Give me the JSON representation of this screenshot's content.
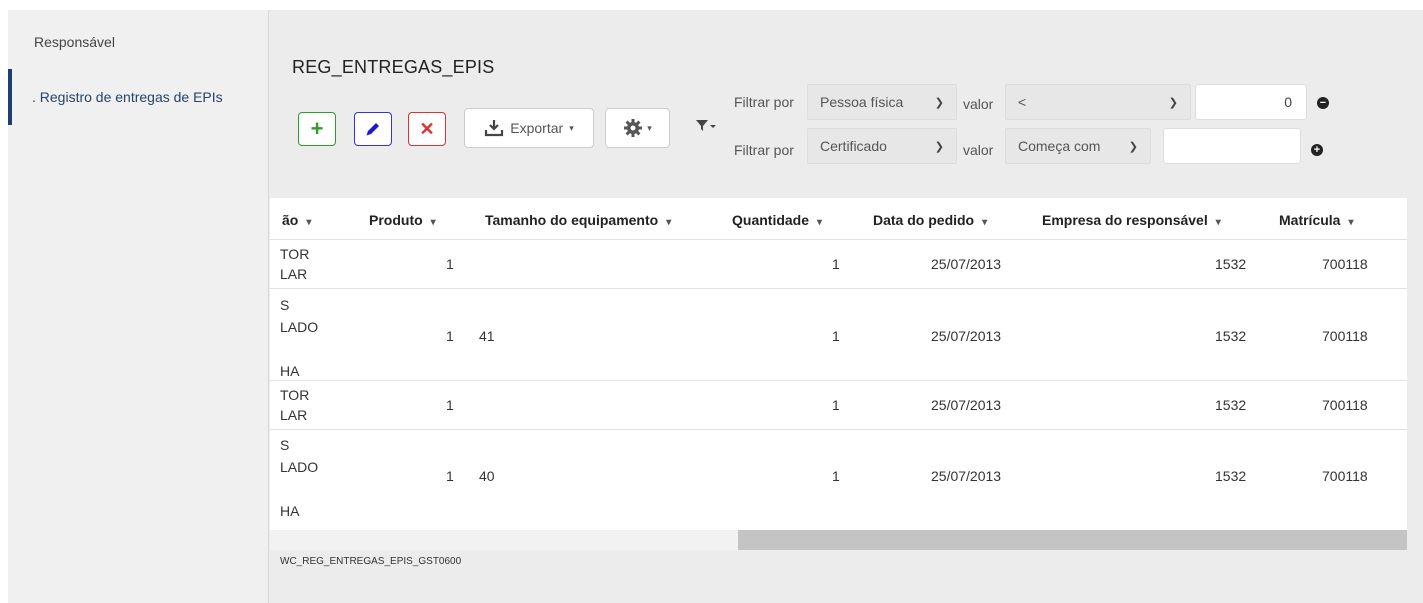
{
  "sidebar": {
    "header": "Responsável",
    "items": [
      {
        "label": ". Registro de entregas de EPIs"
      }
    ]
  },
  "page": {
    "title": "REG_ENTREGAS_EPIS",
    "footer_code": "WC_REG_ENTREGAS_EPIS_GST0600"
  },
  "toolbar": {
    "add_symbol": "+",
    "delete_symbol": "✕",
    "export_label": "Exportar",
    "caret": "▾"
  },
  "filters": [
    {
      "label": "Filtrar por",
      "field": "Pessoa física",
      "value_label": "valor",
      "operator": "<",
      "value": "0",
      "action": "−"
    },
    {
      "label": "Filtrar por",
      "field": "Certificado",
      "value_label": "valor",
      "operator": "Começa com",
      "value": "",
      "action": "+"
    }
  ],
  "table": {
    "columns": [
      "ão",
      "Produto",
      "Tamanho do equipamento",
      "Quantidade",
      "Data do pedido",
      "Empresa do responsável",
      "Matrícula"
    ],
    "sort_arrow": "▾",
    "rows": [
      {
        "cut_lines": [
          "TOR",
          "LAR"
        ],
        "produto": "1",
        "tamanho": "",
        "quantidade": "1",
        "data": "25/07/2013",
        "empresa": "1532",
        "matricula": "700118"
      },
      {
        "cut_lines": [
          "S",
          "LADO",
          "",
          "HA"
        ],
        "produto": "1",
        "tamanho": "41",
        "quantidade": "1",
        "data": "25/07/2013",
        "empresa": "1532",
        "matricula": "700118"
      },
      {
        "cut_lines": [
          "TOR",
          "LAR"
        ],
        "produto": "1",
        "tamanho": "",
        "quantidade": "1",
        "data": "25/07/2013",
        "empresa": "1532",
        "matricula": "700118"
      },
      {
        "cut_lines": [
          "S",
          "LADO",
          "",
          "HA"
        ],
        "produto": "1",
        "tamanho": "40",
        "quantidade": "1",
        "data": "25/07/2013",
        "empresa": "1532",
        "matricula": "700118"
      }
    ]
  }
}
